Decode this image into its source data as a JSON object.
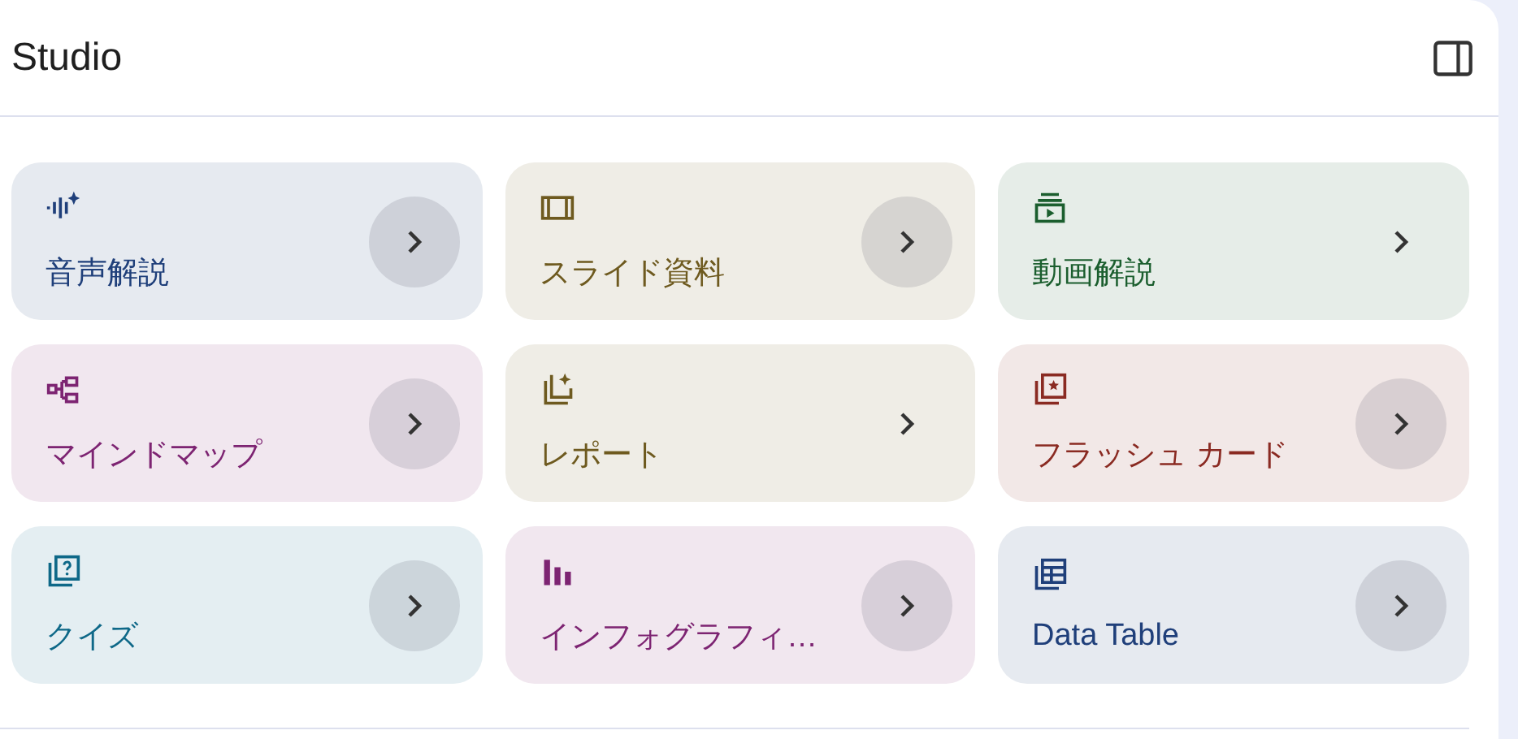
{
  "panel": {
    "title": "Studio"
  },
  "tools": [
    {
      "kind": "audio",
      "label": "音声解説",
      "color": "#1f3f7a",
      "highlighted": true
    },
    {
      "kind": "slides",
      "label": "スライド資料",
      "color": "#6e5a1f",
      "highlighted": true
    },
    {
      "kind": "video",
      "label": "動画解説",
      "color": "#1b5e2e",
      "highlighted": false
    },
    {
      "kind": "mindmap",
      "label": "マインドマップ",
      "color": "#7d2472",
      "highlighted": true
    },
    {
      "kind": "report",
      "label": "レポート",
      "color": "#6e5a1f",
      "highlighted": false
    },
    {
      "kind": "flashcards",
      "label": "フラッシュ カード",
      "color": "#8a2a22",
      "highlighted": true
    },
    {
      "kind": "quiz",
      "label": "クイズ",
      "color": "#0e6888",
      "highlighted": true
    },
    {
      "kind": "infographic",
      "label": "インフォグラフィ…",
      "color": "#7d2472",
      "highlighted": true
    },
    {
      "kind": "table",
      "label": "Data Table",
      "color": "#1f3f7a",
      "highlighted": true
    }
  ]
}
